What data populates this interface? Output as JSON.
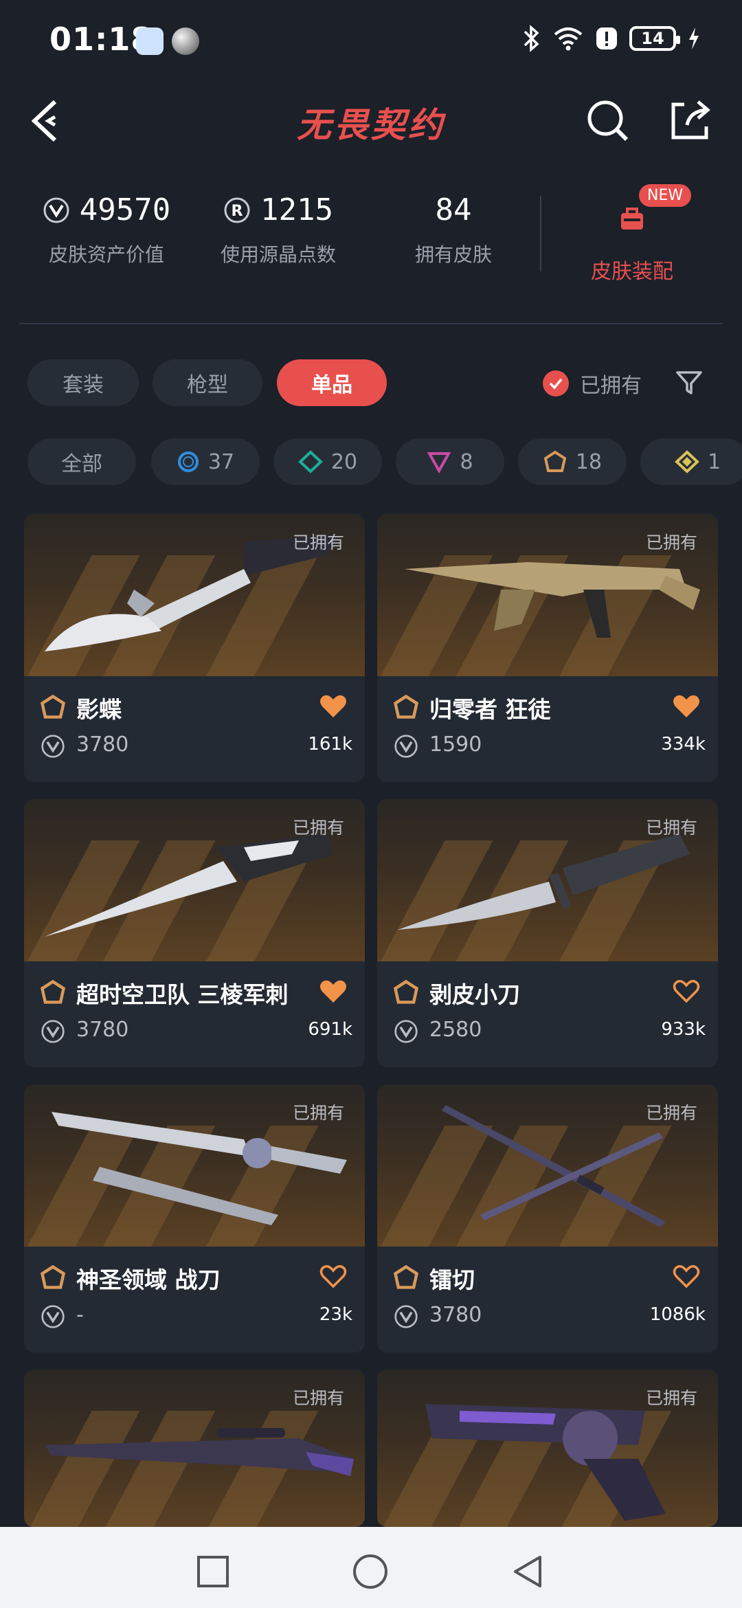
{
  "status_bar": {
    "time": "01:18",
    "battery": "14"
  },
  "app_bar": {
    "title": "无畏契约",
    "back_icon": "back-arrow-icon",
    "search_icon": "search-icon",
    "share_icon": "share-icon"
  },
  "stats": [
    {
      "value": "49570",
      "label": "皮肤资产价值",
      "icon": "vp-coin-icon"
    },
    {
      "value": "1215",
      "label": "使用源晶点数",
      "icon": "radianite-icon"
    },
    {
      "value": "84",
      "label": "拥有皮肤"
    }
  ],
  "loadout": {
    "badge": "NEW",
    "label": "皮肤装配",
    "icon": "loadout-bag-icon"
  },
  "tabs": [
    "套装",
    "枪型",
    "单品"
  ],
  "active_tab": "单品",
  "owned_filter": {
    "label": "已拥有",
    "checked": true
  },
  "tier_filters": [
    {
      "label": "全部"
    },
    {
      "label": "37",
      "color": "#2f8fe0",
      "icon": "select-tier-icon"
    },
    {
      "label": "20",
      "color": "#1fae9a",
      "icon": "deluxe-tier-icon"
    },
    {
      "label": "8",
      "color": "#c84aa6",
      "icon": "premium-tier-icon"
    },
    {
      "label": "18",
      "color": "#d99a5a",
      "icon": "exclusive-tier-icon"
    },
    {
      "label": "1",
      "color": "#d9c25a",
      "icon": "ultra-tier-icon"
    }
  ],
  "items": [
    {
      "name": "影蝶",
      "price": "3780",
      "likes": "161k",
      "owned_tag": "已拥有",
      "liked": true
    },
    {
      "name": "归零者 狂徒",
      "price": "1590",
      "likes": "334k",
      "owned_tag": "已拥有",
      "liked": true
    },
    {
      "name": "超时空卫队 三棱军刺",
      "price": "3780",
      "likes": "691k",
      "owned_tag": "已拥有",
      "liked": true
    },
    {
      "name": "剥皮小刀",
      "price": "2580",
      "likes": "933k",
      "owned_tag": "已拥有",
      "liked": false
    },
    {
      "name": "神圣领域 战刀",
      "price": "-",
      "likes": "23k",
      "owned_tag": "已拥有",
      "liked": false
    },
    {
      "name": "镭切",
      "price": "3780",
      "likes": "1086k",
      "owned_tag": "已拥有",
      "liked": false
    },
    {
      "name": "",
      "price": "",
      "likes": "",
      "owned_tag": "已拥有",
      "liked": false
    },
    {
      "name": "",
      "price": "",
      "likes": "",
      "owned_tag": "已拥有",
      "liked": false
    }
  ],
  "colors": {
    "accent": "#e8504e",
    "background": "#1b2029",
    "card": "#232a34",
    "heart": "#f2934a"
  }
}
